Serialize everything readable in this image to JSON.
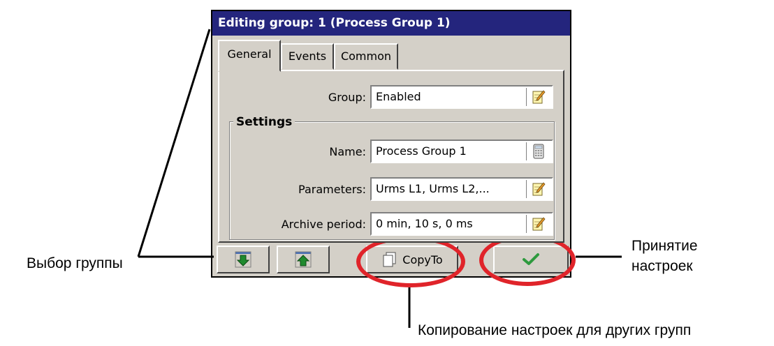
{
  "window": {
    "title": "Editing group: 1 (Process Group 1)"
  },
  "tabs": [
    {
      "label": "General"
    },
    {
      "label": "Events"
    },
    {
      "label": "Common"
    }
  ],
  "general": {
    "group_label": "Group:",
    "group_value": "Enabled",
    "settings_title": "Settings",
    "name_label": "Name:",
    "name_value": "Process Group 1",
    "parameters_label": "Parameters:",
    "parameters_value": "Urms L1, Urms L2,...",
    "archive_label": "Archive period:",
    "archive_value": "0 min, 10 s, 0 ms"
  },
  "buttons": {
    "copy_to_label": "CopyTo"
  },
  "annotations": {
    "group_select": "Выбор группы",
    "accept_line1": "Принятие",
    "accept_line2": "настроек",
    "copy_settings": "Копирование настроек для других групп"
  },
  "colors": {
    "title_bar": "#24257d",
    "highlight": "#e0242a",
    "arrow_green": "#1f8a2e"
  }
}
